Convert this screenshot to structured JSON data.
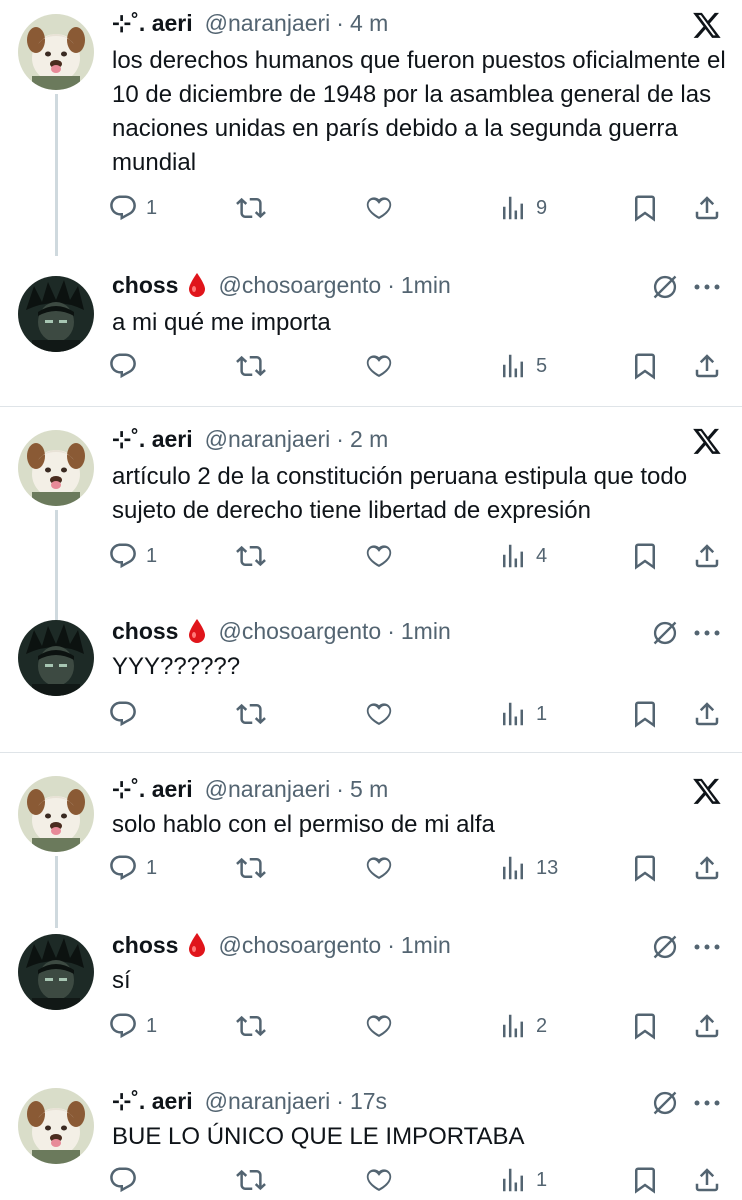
{
  "tweets": [
    {
      "name": "⊹˚. aeri",
      "handle": "@naranjaeri",
      "sep": "·",
      "time": "4 m",
      "text": "los derechos humanos que fueron puestos oficialmente el 10 de diciembre de 1948 por la asamblea general de las naciones unidas en parís debido a la segunda guerra mundial",
      "reply_count": "1",
      "retweet_count": "",
      "like_count": "",
      "view_count": "9",
      "right_icon": "x-logo-icon"
    },
    {
      "name": "choss",
      "handle": "@chosoargento",
      "sep": "·",
      "time": "1min",
      "text": "a mi qué me importa",
      "reply_count": "",
      "retweet_count": "",
      "like_count": "",
      "view_count": "5",
      "right_icon": "grok-icon"
    },
    {
      "name": "⊹˚. aeri",
      "handle": "@naranjaeri",
      "sep": "·",
      "time": "2 m",
      "text": "artículo 2 de la constitución peruana estipula que todo sujeto de derecho tiene libertad de expresión",
      "reply_count": "1",
      "retweet_count": "",
      "like_count": "",
      "view_count": "4",
      "right_icon": "x-logo-icon"
    },
    {
      "name": "choss",
      "handle": "@chosoargento",
      "sep": "·",
      "time": "1min",
      "text": "YYY??????",
      "reply_count": "",
      "retweet_count": "",
      "like_count": "",
      "view_count": "1",
      "right_icon": "grok-icon"
    },
    {
      "name": "⊹˚. aeri",
      "handle": "@naranjaeri",
      "sep": "·",
      "time": "5 m",
      "text": "solo hablo con el permiso de mi alfa",
      "reply_count": "1",
      "retweet_count": "",
      "like_count": "",
      "view_count": "13",
      "right_icon": "x-logo-icon"
    },
    {
      "name": "choss",
      "handle": "@chosoargento",
      "sep": "·",
      "time": "1min",
      "text": "sí",
      "reply_count": "1",
      "retweet_count": "",
      "like_count": "",
      "view_count": "2",
      "right_icon": "grok-icon"
    },
    {
      "name": "⊹˚. aeri",
      "handle": "@naranjaeri",
      "sep": "·",
      "time": "17s",
      "text": "BUE LO ÚNICO QUE LE IMPORTABA",
      "reply_count": "",
      "retweet_count": "",
      "like_count": "",
      "view_count": "1",
      "right_icon": "grok-icon"
    }
  ],
  "colors": {
    "text": "#0f1419",
    "muted": "#536471",
    "divider": "#dfe4e8",
    "thread_line": "#cfd9de",
    "blood_drop": "#e0151b"
  }
}
